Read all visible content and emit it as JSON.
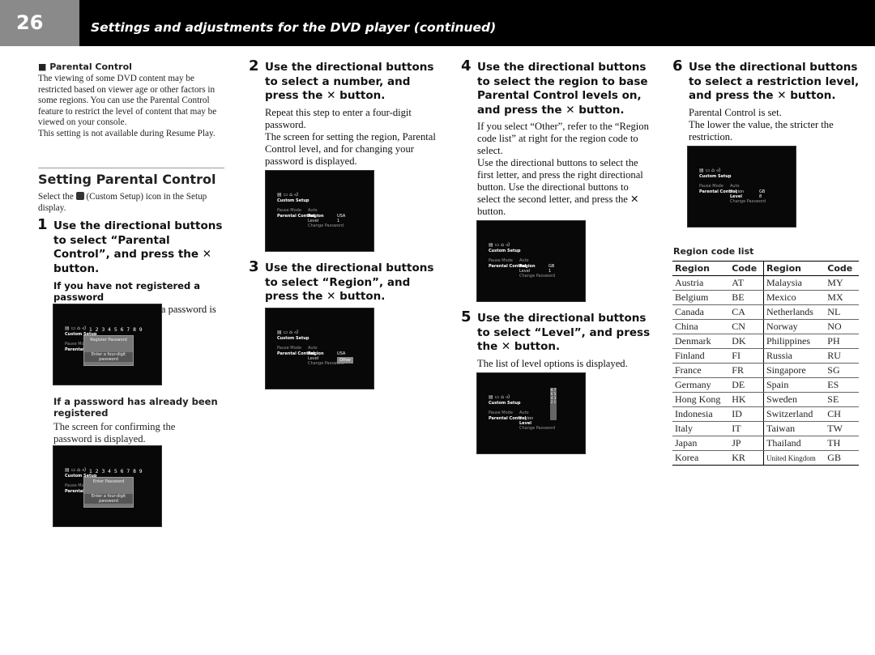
{
  "header": {
    "page_number": "26",
    "title": "Settings and adjustments for the DVD player (continued)"
  },
  "intro": {
    "heading": "Parental Control",
    "body": "The viewing of some DVD content may be restricted based on viewer age or other factors in some regions. You can use the Parental Control feature to restrict the level of content that may be viewed on your console.",
    "note": "This setting is not available during Resume Play."
  },
  "section": {
    "title": "Setting Parental Control",
    "lead_pre": "Select the",
    "lead_post": "(Custom Setup) icon in the Setup display."
  },
  "steps": [
    {
      "num": "1",
      "text": "Use the directional buttons to select “Parental Control”, and press the ✕ button.",
      "sub1": "If you have not registered a password",
      "body1": "The screen for registering a password is displayed.",
      "sub2": "If a password has already been registered",
      "body2": "The screen for confirming the password is displayed."
    },
    {
      "num": "2",
      "text": "Use the directional buttons to select a number, and press the ✕ button.",
      "body": "Repeat this step to enter a four-digit password.",
      "body_b": "The screen for setting the region, Parental Control level, and for changing your password is displayed."
    },
    {
      "num": "3",
      "text": "Use the directional buttons to select “Region”, and press the ✕ button."
    },
    {
      "num": "4",
      "text": "Use the directional buttons to select the region to base Parental Control levels on, and press the ✕ button.",
      "body": "If you select “Other”, refer to the “Region code list” at right for the region code to select.",
      "body_b": "Use the directional buttons to select the first letter, and press the right directional button. Use the directional buttons to select the second letter, and press the ✕ button."
    },
    {
      "num": "5",
      "text": "Use the directional buttons to select “Level”, and press the ✕ button.",
      "body": "The list of level options is displayed."
    },
    {
      "num": "6",
      "text": "Use the directional buttons to select a restriction level, and press the ✕ button.",
      "body": "Parental Control is set.",
      "body_b": "The lower the value, the stricter the restriction."
    }
  ],
  "screen": {
    "icons": "▤ ▭ ⌂ ◃)",
    "custom_setup": "Custom Setup",
    "pause_mode": "Pause Mode",
    "parental_control": "Parental Control",
    "auto": "Auto",
    "region": "Region",
    "level": "Level",
    "change_password": "Change Password",
    "digits": "1 2 3 4 5 6 7 8 9",
    "register_password": "Register Password",
    "enter_password": "Enter Password",
    "enter_prompt": "Enter a four-digit password",
    "usa": "USA",
    "other": "Other",
    "gb": "GB",
    "level1": "1",
    "level8": "8",
    "level_list": "8 7 6 5 4 3 2 1"
  },
  "region_table": {
    "title": "Region code list",
    "headers": [
      "Region",
      "Code",
      "Region",
      "Code"
    ],
    "rows": [
      [
        "Austria",
        "AT",
        "Malaysia",
        "MY"
      ],
      [
        "Belgium",
        "BE",
        "Mexico",
        "MX"
      ],
      [
        "Canada",
        "CA",
        "Netherlands",
        "NL"
      ],
      [
        "China",
        "CN",
        "Norway",
        "NO"
      ],
      [
        "Denmark",
        "DK",
        "Philippines",
        "PH"
      ],
      [
        "Finland",
        "FI",
        "Russia",
        "RU"
      ],
      [
        "France",
        "FR",
        "Singapore",
        "SG"
      ],
      [
        "Germany",
        "DE",
        "Spain",
        "ES"
      ],
      [
        "Hong Kong",
        "HK",
        "Sweden",
        "SE"
      ],
      [
        "Indonesia",
        "ID",
        "Switzerland",
        "CH"
      ],
      [
        "Italy",
        "IT",
        "Taiwan",
        "TW"
      ],
      [
        "Japan",
        "JP",
        "Thailand",
        "TH"
      ],
      [
        "Korea",
        "KR",
        "United Kingdom",
        "GB"
      ]
    ]
  }
}
